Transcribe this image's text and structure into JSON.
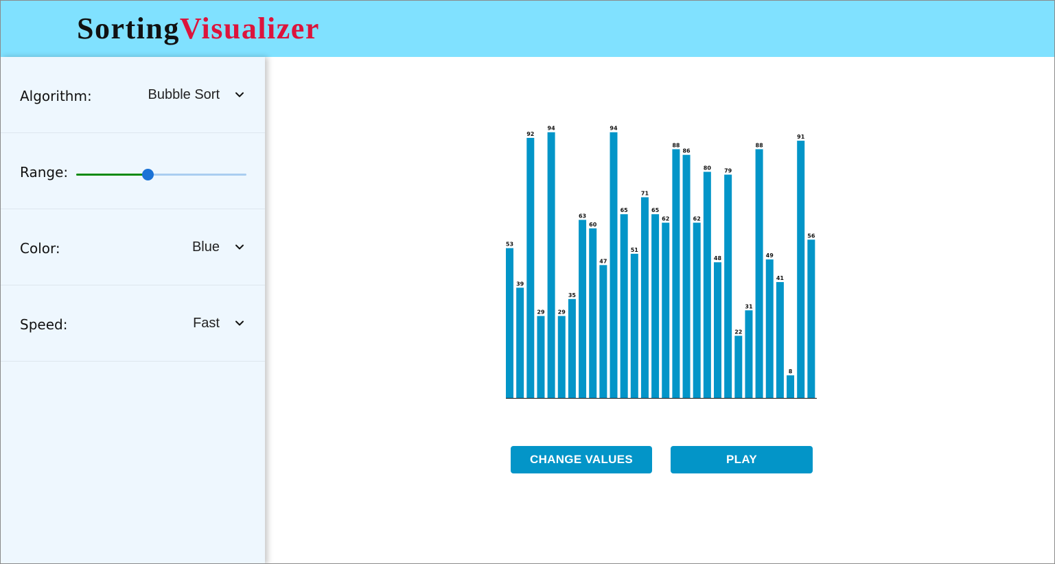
{
  "app": {
    "title_part1": "Sorting",
    "title_part2": "Visualizer"
  },
  "sidebar": {
    "algorithm": {
      "label": "Algorithm:",
      "value": "Bubble Sort"
    },
    "range": {
      "label": "Range:",
      "value_fraction": 0.42
    },
    "color": {
      "label": "Color:",
      "value": "Blue"
    },
    "speed": {
      "label": "Speed:",
      "value": "Fast"
    }
  },
  "buttons": {
    "change_values": "CHANGE VALUES",
    "play": "PLAY"
  },
  "colors": {
    "header": "#80e1ff",
    "title_dark": "#111111",
    "title_accent": "#dc143c",
    "sidebar_bg": "#eef7fe",
    "bar": "#0395c8",
    "slider_active": "#0c8a0c",
    "slider_thumb": "#1b72d6",
    "slider_track": "#a9cdf0"
  },
  "icons": {
    "dropdown": "chevron-down-icon"
  },
  "chart_data": {
    "type": "bar",
    "values": [
      53,
      39,
      92,
      29,
      94,
      29,
      35,
      63,
      60,
      47,
      94,
      65,
      51,
      71,
      65,
      62,
      88,
      86,
      62,
      80,
      48,
      79,
      22,
      31,
      88,
      49,
      41,
      8,
      91,
      56
    ]
  }
}
